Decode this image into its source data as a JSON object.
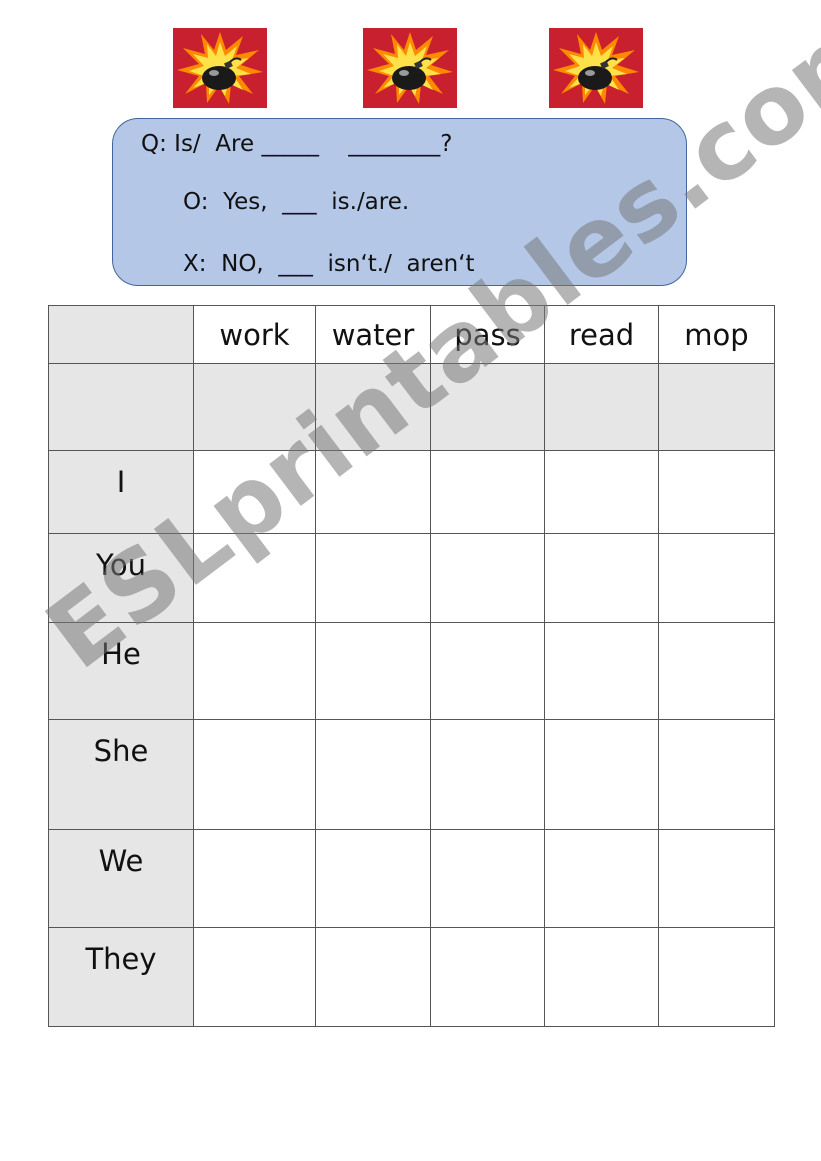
{
  "qa": {
    "question": "Q: Is/  Are _____    ________?",
    "yes": "O:  Yes,  ___  is./are.",
    "no": "X:  NO,  ___  isn‘t./  aren‘t"
  },
  "table": {
    "columns": [
      "work",
      "water",
      "pass",
      "read",
      "mop"
    ],
    "rows": [
      "I",
      "You",
      "He",
      "She",
      "We",
      "They"
    ]
  },
  "watermark": "ESLprintables.com",
  "icons": [
    "bomb-icon",
    "bomb-icon",
    "bomb-icon"
  ],
  "colors": {
    "box_fill": "#b4c7e7",
    "box_border": "#41659c",
    "shaded_cell": "#e7e6e6",
    "bomb_bg": "#c8202e",
    "burst": "#ffd21a"
  }
}
